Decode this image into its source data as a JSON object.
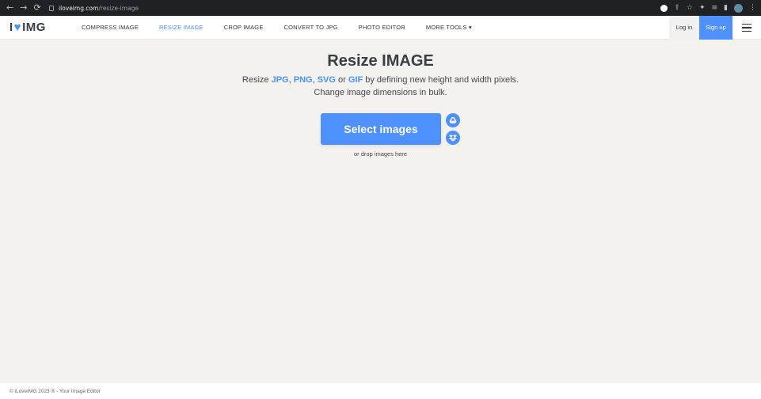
{
  "browser": {
    "url_host": "iloveimg.com",
    "url_path": "/resize-image",
    "back_icon": "arrow-left-icon",
    "forward_icon": "arrow-right-icon",
    "reload_icon": "reload-icon"
  },
  "header": {
    "logo_left": "I",
    "logo_right": "IMG",
    "menu": [
      {
        "label": "COMPRESS IMAGE"
      },
      {
        "label": "RESIZE IMAGE"
      },
      {
        "label": "CROP IMAGE"
      },
      {
        "label": "CONVERT TO JPG"
      },
      {
        "label": "PHOTO EDITOR"
      },
      {
        "label": "MORE TOOLS"
      }
    ],
    "login": "Log in",
    "signup": "Sign up"
  },
  "main": {
    "title": "Resize IMAGE",
    "sub_prefix": "Resize ",
    "formats": [
      "JPG",
      "PNG",
      "SVG",
      "GIF"
    ],
    "sep1": ", ",
    "sep2": ", ",
    "sep3": " or ",
    "sub_suffix": " by defining new height and width pixels.",
    "sub_line2": "Change image dimensions in bulk.",
    "select_button": "Select images",
    "drop_hint": "or drop images here"
  },
  "footer": {
    "text": "© iLoveIMG 2023 ® - Your Image Editor"
  },
  "colors": {
    "accent": "#4d90fe",
    "background": "#f4f2ee",
    "chrome": "#202124"
  }
}
